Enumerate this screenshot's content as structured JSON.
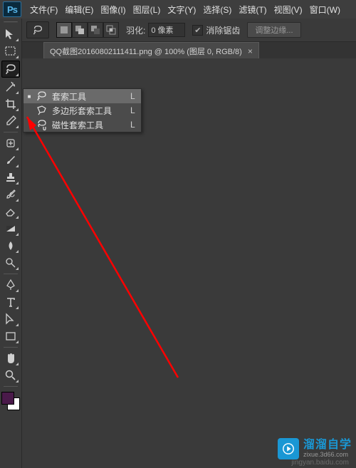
{
  "menubar": {
    "items": [
      {
        "label": "文件(F)"
      },
      {
        "label": "编辑(E)"
      },
      {
        "label": "图像(I)"
      },
      {
        "label": "图层(L)"
      },
      {
        "label": "文字(Y)"
      },
      {
        "label": "选择(S)"
      },
      {
        "label": "滤镜(T)"
      },
      {
        "label": "视图(V)"
      },
      {
        "label": "窗口(W)"
      }
    ],
    "logo_text": "Ps"
  },
  "options_bar": {
    "feather_label": "羽化:",
    "feather_value": "0 像素",
    "antialias_label": "消除锯齿",
    "antialias_checked": true,
    "refine_label": "调整边缘..."
  },
  "doc_tab": {
    "title": "QQ截图20160802111411.png @ 100% (图层 0, RGB/8)",
    "close": "×"
  },
  "toolbar": {
    "tools": [
      {
        "name": "move-tool-icon"
      },
      {
        "name": "marquee-tool-icon"
      },
      {
        "name": "lasso-tool-icon",
        "selected": true
      },
      {
        "name": "magic-wand-tool-icon"
      },
      {
        "name": "crop-tool-icon"
      },
      {
        "name": "eyedropper-tool-icon"
      },
      {
        "name": "healing-brush-tool-icon"
      },
      {
        "name": "brush-tool-icon"
      },
      {
        "name": "stamp-tool-icon"
      },
      {
        "name": "history-brush-tool-icon"
      },
      {
        "name": "eraser-tool-icon"
      },
      {
        "name": "gradient-tool-icon"
      },
      {
        "name": "blur-tool-icon"
      },
      {
        "name": "dodge-tool-icon"
      },
      {
        "name": "pen-tool-icon"
      },
      {
        "name": "type-tool-icon"
      },
      {
        "name": "path-select-tool-icon"
      },
      {
        "name": "shape-tool-icon"
      },
      {
        "name": "hand-tool-icon"
      },
      {
        "name": "zoom-tool-icon"
      }
    ]
  },
  "lasso_flyout": {
    "items": [
      {
        "label": "套索工具",
        "shortcut": "L",
        "selected": true,
        "icon": "lasso-icon"
      },
      {
        "label": "多边形套索工具",
        "shortcut": "L",
        "selected": false,
        "icon": "polygonal-lasso-icon"
      },
      {
        "label": "磁性套索工具",
        "shortcut": "L",
        "selected": false,
        "icon": "magnetic-lasso-icon"
      }
    ]
  },
  "watermark": {
    "title": "溜溜自学",
    "sub": "zixue.3d66.com",
    "url": "jingyan.baidu.com"
  },
  "colors": {
    "fg": "#4a1a4a",
    "bg": "#ffffff",
    "anno_red": "#ff0000",
    "brand_blue": "#1a97d4"
  }
}
